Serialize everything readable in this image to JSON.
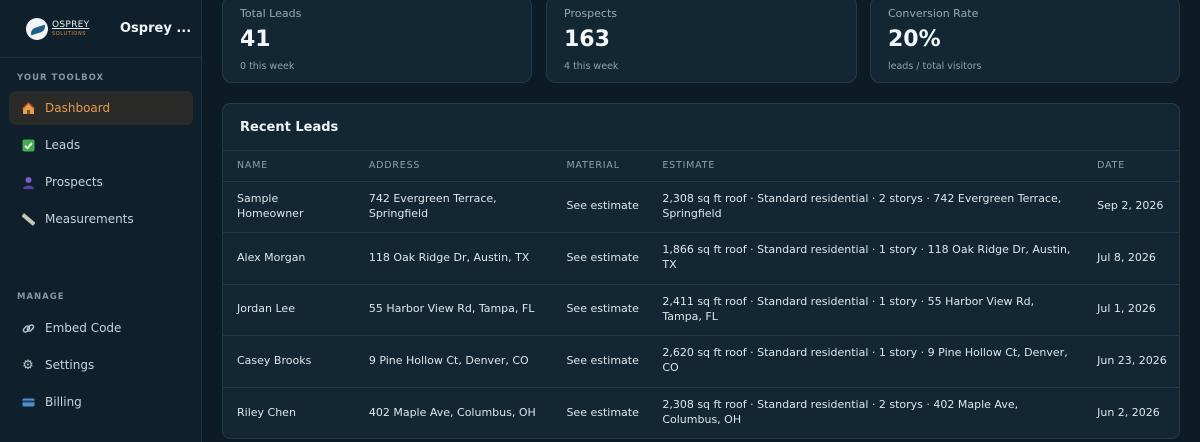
{
  "brand": {
    "logo_line1": "OSPREY",
    "logo_line2": "SOLUTIONS",
    "name": "Osprey ..."
  },
  "sidebar": {
    "toolbox_label": "YOUR TOOLBOX",
    "manage_label": "MANAGE",
    "toolbox_items": [
      {
        "label": "Dashboard",
        "icon": "house-icon",
        "active": true
      },
      {
        "label": "Leads",
        "icon": "checkbox-icon"
      },
      {
        "label": "Prospects",
        "icon": "person-icon"
      },
      {
        "label": "Measurements",
        "icon": "ruler-icon"
      }
    ],
    "manage_items": [
      {
        "label": "Embed Code",
        "icon": "link-icon"
      },
      {
        "label": "Settings",
        "icon": "gear-icon"
      },
      {
        "label": "Billing",
        "icon": "credit-card-icon"
      }
    ]
  },
  "stats": [
    {
      "label": "Total Leads",
      "value": "41",
      "sub": "0 this week"
    },
    {
      "label": "Prospects",
      "value": "163",
      "sub": "4 this week"
    },
    {
      "label": "Conversion Rate",
      "value": "20%",
      "sub": "leads / total visitors"
    }
  ],
  "recent_leads": {
    "title": "Recent Leads",
    "columns": [
      "NAME",
      "ADDRESS",
      "MATERIAL",
      "ESTIMATE",
      "DATE"
    ],
    "rows": [
      {
        "name": "Sample Homeowner",
        "address": "742 Evergreen Terrace, Springfield",
        "material": "See estimate",
        "estimate": "2,308 sq ft roof · Standard residential · 2 storys · 742 Evergreen Terrace, Springfield",
        "date": "Sep 2, 2026"
      },
      {
        "name": "Alex Morgan",
        "address": "118 Oak Ridge Dr, Austin, TX",
        "material": "See estimate",
        "estimate": "1,866 sq ft roof · Standard residential · 1 story · 118 Oak Ridge Dr, Austin, TX",
        "date": "Jul 8, 2026"
      },
      {
        "name": "Jordan Lee",
        "address": "55 Harbor View Rd, Tampa, FL",
        "material": "See estimate",
        "estimate": "2,411 sq ft roof · Standard residential · 1 story · 55 Harbor View Rd, Tampa, FL",
        "date": "Jul 1, 2026"
      },
      {
        "name": "Casey Brooks",
        "address": "9 Pine Hollow Ct, Denver, CO",
        "material": "See estimate",
        "estimate": "2,620 sq ft roof · Standard residential · 1 story · 9 Pine Hollow Ct, Denver, CO",
        "date": "Jun 23, 2026"
      },
      {
        "name": "Riley Chen",
        "address": "402 Maple Ave, Columbus, OH",
        "material": "See estimate",
        "estimate": "2,308 sq ft roof · Standard residential · 2 storys · 402 Maple Ave, Columbus, OH",
        "date": "Jun 2, 2026"
      }
    ]
  },
  "colors": {
    "background": "#0c1b26",
    "sidebar": "#0f202c",
    "card": "#122633",
    "accent": "#e89a4a",
    "active_bg": "#2a2a28"
  }
}
